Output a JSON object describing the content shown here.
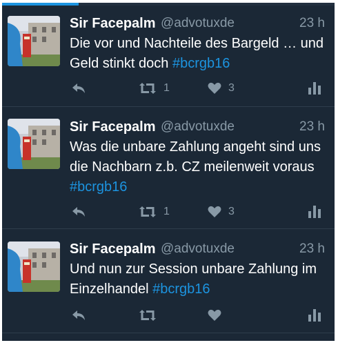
{
  "progress": {
    "value_percent": 23,
    "color": "#1c94e0"
  },
  "colors": {
    "background": "#1b2836",
    "hashtag": "#1c94e0",
    "muted": "#8899a6"
  },
  "tweets": [
    {
      "author": "Sir Facepalm",
      "handle": "@advotuxde",
      "time": "23 h",
      "text": "Die vor und Nachteile des Bargeld … und Geld stinkt doch",
      "hashtag": "#bcrgb16",
      "retweets": "1",
      "likes": "3",
      "icons": [
        "reply-icon",
        "retweet-icon",
        "heart-icon",
        "analytics-icon"
      ]
    },
    {
      "author": "Sir Facepalm",
      "handle": "@advotuxde",
      "time": "23 h",
      "text": "Was die unbare Zahlung angeht sind uns die Nachbarn z.b. CZ meilenweit voraus",
      "hashtag": "#bcrgb16",
      "retweets": "1",
      "likes": "3",
      "icons": [
        "reply-icon",
        "retweet-icon",
        "heart-icon",
        "analytics-icon"
      ]
    },
    {
      "author": "Sir Facepalm",
      "handle": "@advotuxde",
      "time": "23 h",
      "text": "Und nun zur Session unbare Zahlung im Einzelhandel",
      "hashtag": "#bcrgb16",
      "retweets": "",
      "likes": "",
      "icons": [
        "reply-icon",
        "retweet-icon",
        "heart-icon",
        "analytics-icon"
      ]
    }
  ]
}
